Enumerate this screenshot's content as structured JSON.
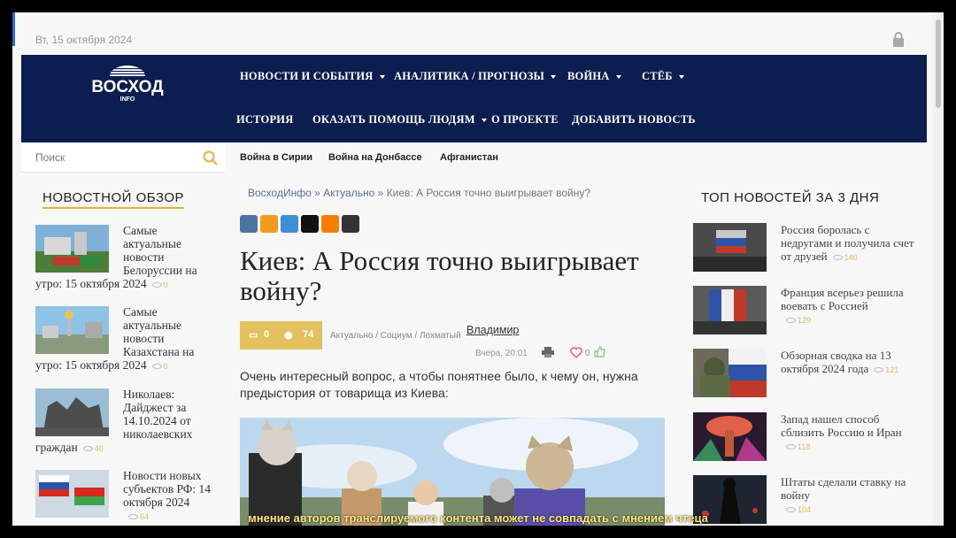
{
  "topbar": {
    "date": "Вт, 15 октября 2024"
  },
  "logo": {
    "name": "ВОСХОД",
    "sub": "INFO"
  },
  "menu": {
    "row1": [
      "НОВОСТИ И СОБЫТИЯ",
      "АНАЛИТИКА / ПРОГНОЗЫ",
      "ВОЙНА",
      "СТЁБ"
    ],
    "row2": [
      "ИСТОРИЯ",
      "ОКАЗАТЬ ПОМОЩЬ ЛЮДЯМ",
      "О ПРОЕКТЕ",
      "ДОБАВИТЬ НОВОСТЬ"
    ]
  },
  "search": {
    "placeholder": "Поиск"
  },
  "tags": [
    "Война в Сирии",
    "Война на Донбассе",
    "Афганистан"
  ],
  "left": {
    "title": "НОВОСТНОЙ ОБЗОР",
    "items": [
      {
        "title": "Самые актуальные новости Белоруссии на утро: 15 октября 2024",
        "views": "0"
      },
      {
        "title": "Самые актуальные новости Казахстана на утро: 15 октября 2024",
        "views": "0"
      },
      {
        "title": "Николаев: Дайджест за 14.10.2024 от николаевских граждан",
        "views": "40"
      },
      {
        "title": "Новости новых субъектов РФ: 14 октября 2024",
        "views": "64"
      }
    ]
  },
  "article": {
    "breadcrumb": [
      "ВосходИнфо",
      "Актуально",
      "Киев: А Россия точно выигрывает войну?"
    ],
    "breadcrumb_sep": "»",
    "title": "Киев: А Россия точно выигрывает войну?",
    "comments": "0",
    "views": "74",
    "categories": "Актуально / Социум / Лохматый",
    "author": "Владимир",
    "time": "Вчера, 20:01",
    "likes": "0",
    "intro": "Очень интересный вопрос, а чтобы понятнее было, к чему он, нужна предыстория от товарища из Киева:"
  },
  "right": {
    "title": "ТОП НОВОСТЕЙ ЗА 3 ДНЯ",
    "items": [
      {
        "title": "Россия боролась с недругами и получила счет от друзей",
        "views": "140"
      },
      {
        "title": "Франция всерьез решила воевать с Россией",
        "views": "129"
      },
      {
        "title": "Обзорная сводка на 13 октября 2024 года",
        "views": "121"
      },
      {
        "title": "Запад нашел способ сблизить Россию и Иран",
        "views": "118"
      },
      {
        "title": "Штаты сделали ставку на войну",
        "views": "104"
      }
    ]
  },
  "subtitle": "мнение авторов транслируемого контента может не совпадать с мнением чтеца"
}
